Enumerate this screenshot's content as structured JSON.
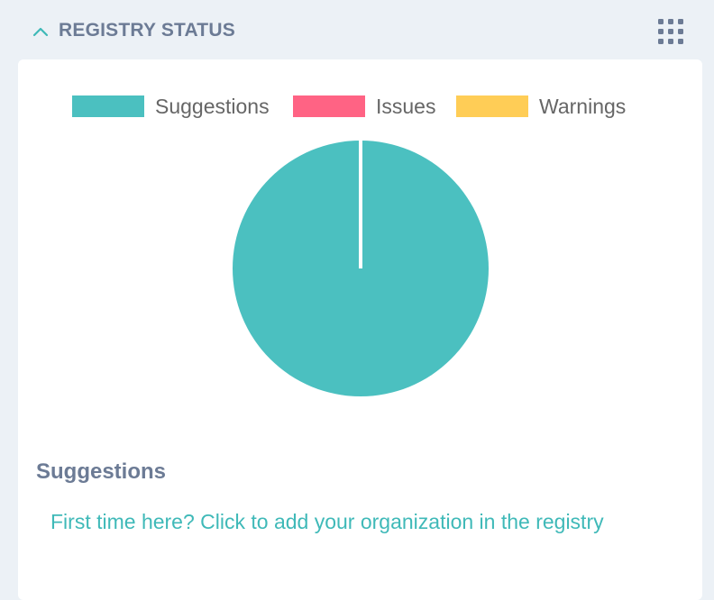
{
  "header": {
    "title": "REGISTRY STATUS",
    "collapse_icon": "chevron-up-icon",
    "menu_icon": "grid-dots-icon"
  },
  "legend": [
    {
      "label": "Suggestions",
      "color": "#4bc0c0"
    },
    {
      "label": "Issues",
      "color": "#ff6384"
    },
    {
      "label": "Warnings",
      "color": "#ffcd56"
    }
  ],
  "chart_data": {
    "type": "pie",
    "categories": [
      "Suggestions",
      "Issues",
      "Warnings"
    ],
    "values": [
      1,
      0,
      0
    ],
    "colors": [
      "#4bc0c0",
      "#ff6384",
      "#ffcd56"
    ],
    "legend_position": "top"
  },
  "section": {
    "heading": "Suggestions",
    "link_text": "First time here? Click to add your organization in the registry"
  }
}
